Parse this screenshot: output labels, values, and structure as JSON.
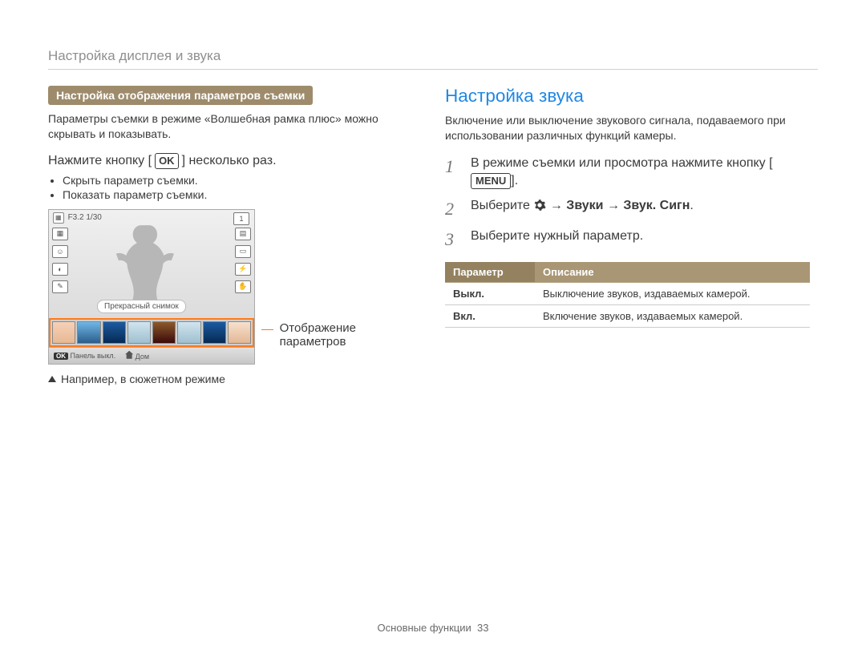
{
  "header": {
    "title": "Настройка дисплея и звука"
  },
  "left": {
    "pill": "Настройка отображения параметров съемки",
    "intro": "Параметры съемки в режиме «Волшебная рамка плюс» можно скрывать и показывать.",
    "instr_pre": "Нажмите кнопку [",
    "ok_label": "OK",
    "instr_post": "] несколько раз.",
    "bullets": [
      "Скрыть параметр съемки.",
      "Показать параметр съемки."
    ],
    "cam": {
      "top_left_extra": "F3.2 1/30",
      "top_right_batt": "1",
      "tooltip": "Прекрасный снимок",
      "bottom_ok": "OK",
      "bottom_panel": "Панель выкл.",
      "bottom_home": "Дом"
    },
    "callout": "Отображение параметров",
    "caption": "Например, в сюжетном режиме"
  },
  "right": {
    "heading": "Настройка звука",
    "intro": "Включение или выключение звукового сигнала, подаваемого при использовании различных функций камеры.",
    "steps": {
      "s1_pre": "В режиме съемки или просмотра нажмите кнопку",
      "s1_btn": "MENU",
      "s1_post": ".",
      "s2_pre": "Выберите ",
      "s2_bold": "→ Звуки → Звук. Сигн",
      "s2_post": ".",
      "s3": "Выберите нужный параметр."
    },
    "table": {
      "head_param": "Параметр",
      "head_desc": "Описание",
      "rows": [
        {
          "label": "Выкл.",
          "desc": "Выключение звуков, издаваемых камерой."
        },
        {
          "label": "Вкл.",
          "desc": "Включение звуков, издаваемых камерой."
        }
      ]
    }
  },
  "footer": {
    "section": "Основные функции",
    "page": "33"
  }
}
